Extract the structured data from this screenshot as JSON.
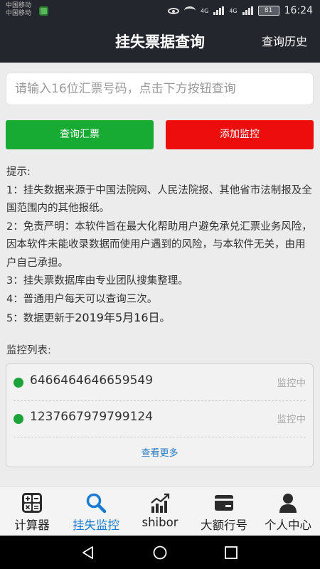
{
  "status_bar": {
    "carrier_1": "中国移动",
    "carrier_2": "中国移动",
    "signal_1": "4G",
    "signal_2": "4G",
    "battery": "81",
    "time": "16:24"
  },
  "header": {
    "title": "挂失票据查询",
    "history_link": "查询历史"
  },
  "search": {
    "placeholder": "请输入16位汇票号码，点击下方按钮查询",
    "value": ""
  },
  "actions": {
    "query_button": "查询汇票",
    "monitor_button": "添加监控",
    "query_color": "#18ab33",
    "monitor_color": "#ee0d0d"
  },
  "tips": {
    "heading": "提示:",
    "items": [
      "1：挂失数据来源于中国法院网、人民法院报、其他省市法制报及全国范围内的其他报纸。",
      "2：免责严明：本软件旨在最大化帮助用户避免承兑汇票业务风险，因本软件未能收录数据而使用户遇到的风险，与本软件无关，由用户自己承担。",
      "3：挂失票数据库由专业团队搜集整理。",
      "4：普通用户每天可以查询三次。"
    ],
    "update_prefix": "5：数据更新于",
    "update_date": "2019年5月16日",
    "update_suffix": "。"
  },
  "monitor": {
    "title": "监控列表:",
    "items": [
      {
        "number": "6466464646659549",
        "status": "监控中"
      },
      {
        "number": "1237667979799124",
        "status": "监控中"
      }
    ],
    "more_link": "查看更多"
  },
  "tabbar": {
    "items": [
      {
        "label": "计算器",
        "icon": "calculator-icon"
      },
      {
        "label": "挂失监控",
        "icon": "search-icon",
        "active": true
      },
      {
        "label": "shibor",
        "icon": "trend-chart-icon"
      },
      {
        "label": "大额行号",
        "icon": "card-icon"
      },
      {
        "label": "个人中心",
        "icon": "person-icon"
      }
    ],
    "active_color": "#1a7bd2"
  },
  "system_nav": {
    "back": "back-icon",
    "home": "home-icon",
    "recents": "recents-icon"
  }
}
